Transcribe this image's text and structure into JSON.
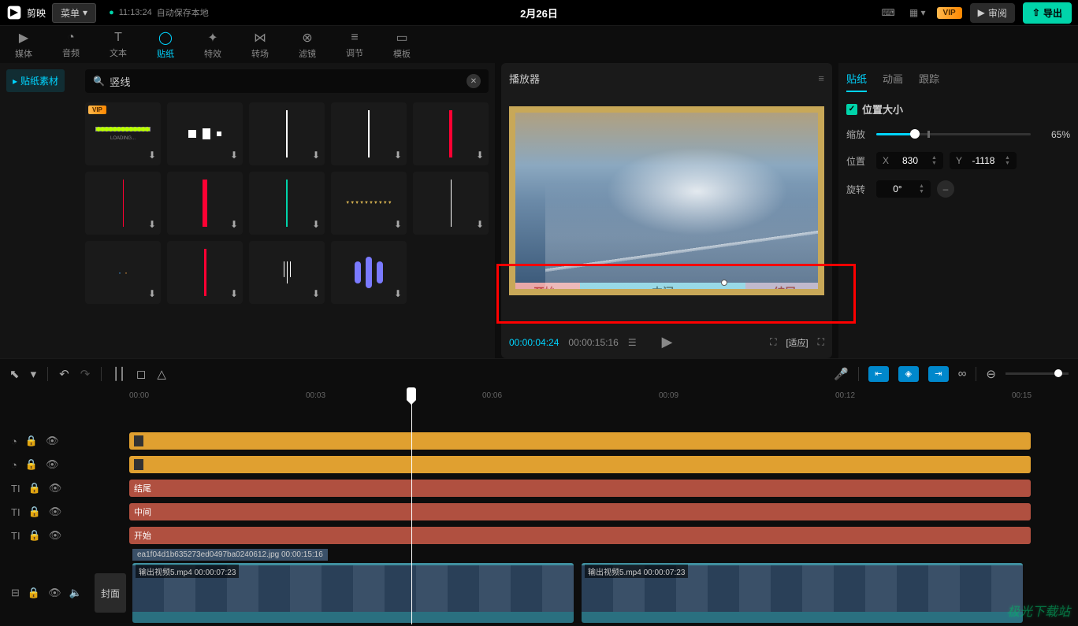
{
  "app": {
    "name": "剪映",
    "menu": "菜单",
    "autosave_time": "11:13:24",
    "autosave_text": "自动保存本地",
    "project_title": "2月26日"
  },
  "topbar_right": {
    "review": "审阅",
    "export": "导出",
    "vip": "VIP"
  },
  "nav": [
    {
      "id": "media",
      "label": "媒体"
    },
    {
      "id": "audio",
      "label": "音频"
    },
    {
      "id": "text",
      "label": "文本"
    },
    {
      "id": "sticker",
      "label": "贴纸",
      "active": true
    },
    {
      "id": "effect",
      "label": "特效"
    },
    {
      "id": "transition",
      "label": "转场"
    },
    {
      "id": "filter",
      "label": "滤镜"
    },
    {
      "id": "adjust",
      "label": "调节"
    },
    {
      "id": "template",
      "label": "模板"
    }
  ],
  "sidebar": {
    "tab": "贴纸素材"
  },
  "search": {
    "value": "竖线",
    "placeholder": ""
  },
  "player": {
    "header": "播放器",
    "current": "00:00:04:24",
    "duration": "00:00:15:16",
    "fit": "适应",
    "chapters": [
      "开始",
      "中间",
      "结尾"
    ]
  },
  "props": {
    "tabs": [
      "贴纸",
      "动画",
      "跟踪"
    ],
    "section": "位置大小",
    "scale_label": "缩放",
    "scale_value": "65%",
    "pos_label": "位置",
    "pos_x_label": "X",
    "pos_x": "830",
    "pos_y_label": "Y",
    "pos_y": "-1118",
    "rot_label": "旋转",
    "rot_value": "0°"
  },
  "ruler": [
    "00:00",
    "00:03",
    "00:06",
    "00:09",
    "00:12",
    "00:15"
  ],
  "tracks": {
    "text_clips": [
      "结尾",
      "中间",
      "开始"
    ],
    "video_info": "ea1f04d1b635273ed0497ba0240612.jpg  00:00:15:16",
    "video_label1": "输出视频5.mp4  00:00:07:23",
    "video_label2": "输出视频5.mp4  00:00:07:23",
    "cover": "封面"
  },
  "watermark": "极光下载站"
}
